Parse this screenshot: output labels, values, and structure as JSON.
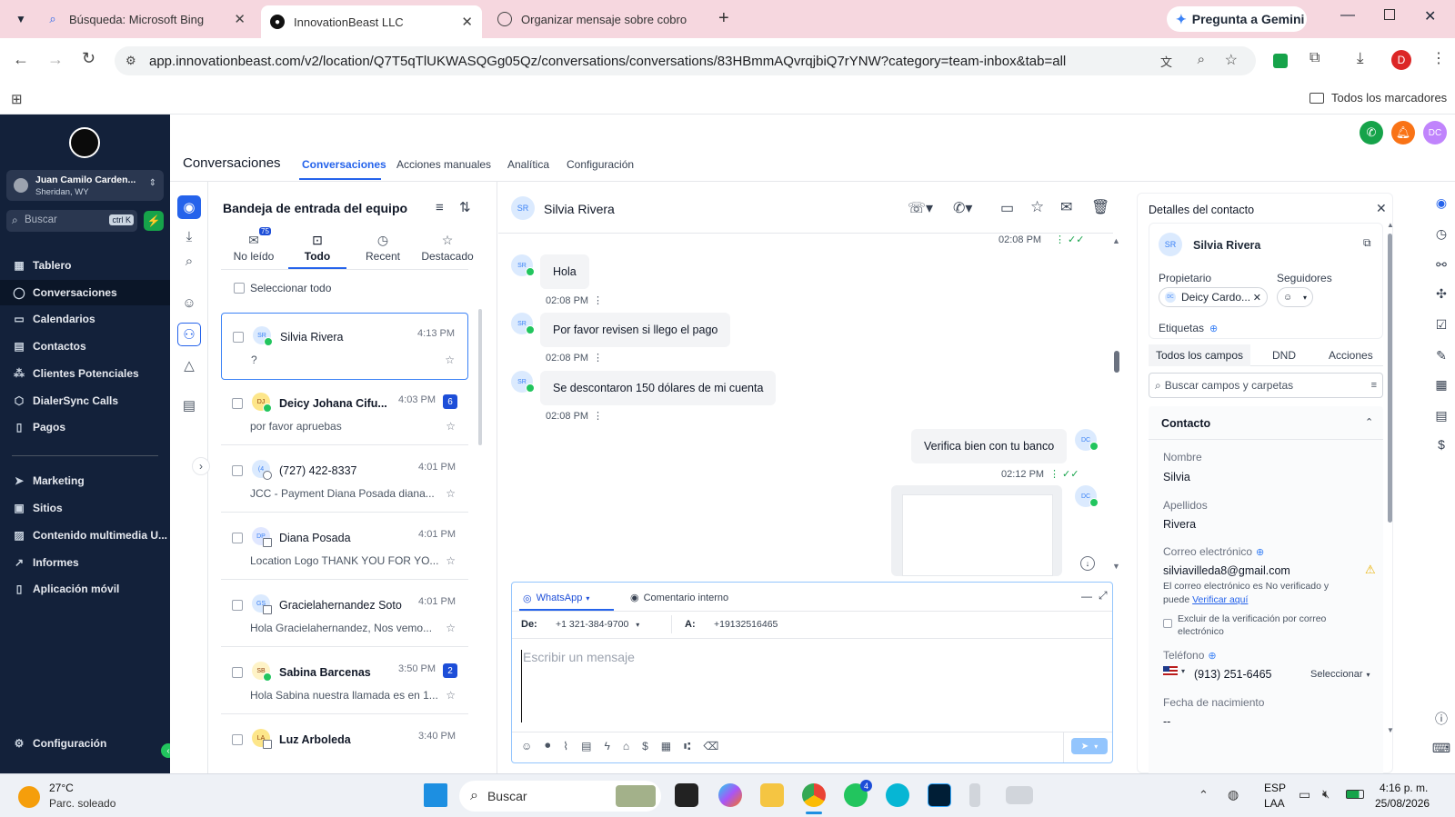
{
  "browser": {
    "tabs": [
      {
        "title": "Búsqueda: Microsoft Bing"
      },
      {
        "title": "InnovationBeast LLC"
      },
      {
        "title": "Organizar mensaje sobre cobro"
      }
    ],
    "gemini_label": "Pregunta a Gemini",
    "url": "app.innovationbeast.com/v2/location/Q7T5qTlUKWASQGg05Qz/conversations/conversations/83HBmmAQvrqjbiQ7rYNW?category=team-inbox&tab=all",
    "profile_initial": "D",
    "bookmarks_label": "Todos los marcadores"
  },
  "sidebar": {
    "account_name": "Juan Camilo Carden...",
    "account_location": "Sheridan, WY",
    "search_placeholder": "Buscar",
    "search_shortcut": "ctrl K",
    "items": [
      {
        "label": "Tablero"
      },
      {
        "label": "Conversaciones"
      },
      {
        "label": "Calendarios"
      },
      {
        "label": "Contactos"
      },
      {
        "label": "Clientes Potenciales"
      },
      {
        "label": "DialerSync Calls"
      },
      {
        "label": "Pagos"
      }
    ],
    "items2": [
      {
        "label": "Marketing"
      },
      {
        "label": "Sitios"
      },
      {
        "label": "Contenido multimedia U..."
      },
      {
        "label": "Informes"
      },
      {
        "label": "Aplicación móvil"
      }
    ],
    "settings_label": "Configuración"
  },
  "header": {
    "title": "Conversaciones",
    "tabs": [
      {
        "label": "Conversaciones"
      },
      {
        "label": "Acciones manuales"
      },
      {
        "label": "Analítica"
      },
      {
        "label": "Configuración"
      }
    ],
    "user_initials": "DC"
  },
  "inbox": {
    "title": "Bandeja de entrada del equipo",
    "tabs": [
      {
        "label": "No leído",
        "badge": "75"
      },
      {
        "label": "Todo"
      },
      {
        "label": "Recent"
      },
      {
        "label": "Destacado"
      }
    ],
    "select_all": "Seleccionar todo",
    "conversations": [
      {
        "initials": "SR",
        "name": "Silvia Rivera",
        "time": "4:13 PM",
        "preview": "?",
        "badge": ""
      },
      {
        "initials": "DJ",
        "name": "Deicy Johana Cifu...",
        "time": "4:03 PM",
        "preview": "por favor apruebas",
        "badge": "6"
      },
      {
        "initials": "(4",
        "name": "(727) 422-8337",
        "time": "4:01 PM",
        "preview": "JCC - Payment Diana Posada diana...",
        "badge": ""
      },
      {
        "initials": "DP",
        "name": "Diana Posada",
        "time": "4:01 PM",
        "preview": "Location Logo THANK YOU FOR YO...",
        "badge": ""
      },
      {
        "initials": "GS",
        "name": "Gracielahernandez Soto",
        "time": "4:01 PM",
        "preview": "Hola Gracielahernandez, Nos vemo...",
        "badge": ""
      },
      {
        "initials": "SB",
        "name": "Sabina Barcenas",
        "time": "3:50 PM",
        "preview": "Hola Sabina nuestra llamada es en 1...",
        "badge": "2"
      },
      {
        "initials": "LA",
        "name": "Luz Arboleda",
        "time": "3:40 PM",
        "preview": "",
        "badge": ""
      }
    ]
  },
  "chat": {
    "contact_initials": "SR",
    "contact_name": "Silvia Rivera",
    "top_time": "02:08 PM",
    "messages": [
      {
        "initials": "SR",
        "text": "Hola",
        "time": "02:08 PM"
      },
      {
        "initials": "SR",
        "text": "Por favor revisen si llego el pago",
        "time": "02:08 PM"
      },
      {
        "initials": "SR",
        "text": "Se descontaron 150 dólares de mi cuenta",
        "time": "02:08 PM"
      }
    ],
    "outgoing": {
      "initials": "DC",
      "text": "Verifica bien con tu banco",
      "time": "02:12 PM"
    },
    "outgoing_image_initials": "DC",
    "composer": {
      "channel": "WhatsApp",
      "internal_comment": "Comentario interno",
      "from_label": "De:",
      "from_number": "+1 321-384-9700",
      "to_label": "A:",
      "to_number": "+19132516465",
      "placeholder": "Escribir un mensaje"
    }
  },
  "details": {
    "title": "Detalles del contacto",
    "contact_initials": "SR",
    "contact_name": "Silvia Rivera",
    "owner_label": "Propietario",
    "owner_initials": "DC",
    "owner_value": "Deicy Cardo...",
    "followers_label": "Seguidores",
    "tags_label": "Etiquetas",
    "tabs": [
      {
        "label": "Todos los campos"
      },
      {
        "label": "DND"
      },
      {
        "label": "Acciones"
      }
    ],
    "search_placeholder": "Buscar campos y carpetas",
    "section_title": "Contacto",
    "first_name_label": "Nombre",
    "first_name": "Silvia",
    "last_name_label": "Apellidos",
    "last_name": "Rivera",
    "email_label": "Correo electrónico",
    "email": "silviavilleda8@gmail.com",
    "email_note": "El correo electrónico es No verificado y puede",
    "verify_link": "Verificar aquí",
    "exclude_label": "Excluir de la verificación por correo electrónico",
    "phone_label": "Teléfono",
    "phone": "(913) 251-6465",
    "phone_select": "Seleccionar",
    "birthday_label": "Fecha de nacimiento",
    "birthday_value": "--"
  },
  "taskbar": {
    "weather_temp": "27°C",
    "weather_desc": "Parc. soleado",
    "search_label": "Buscar",
    "whatsapp_badge": "4",
    "lang1": "ESP",
    "lang2": "LAA",
    "time": "4:16 p. m.",
    "date": "25/08/2026"
  },
  "colors": {
    "sidebar_bg": "#13213a",
    "accent": "#2563eb",
    "tabbar_bg": "#f6d7df"
  }
}
